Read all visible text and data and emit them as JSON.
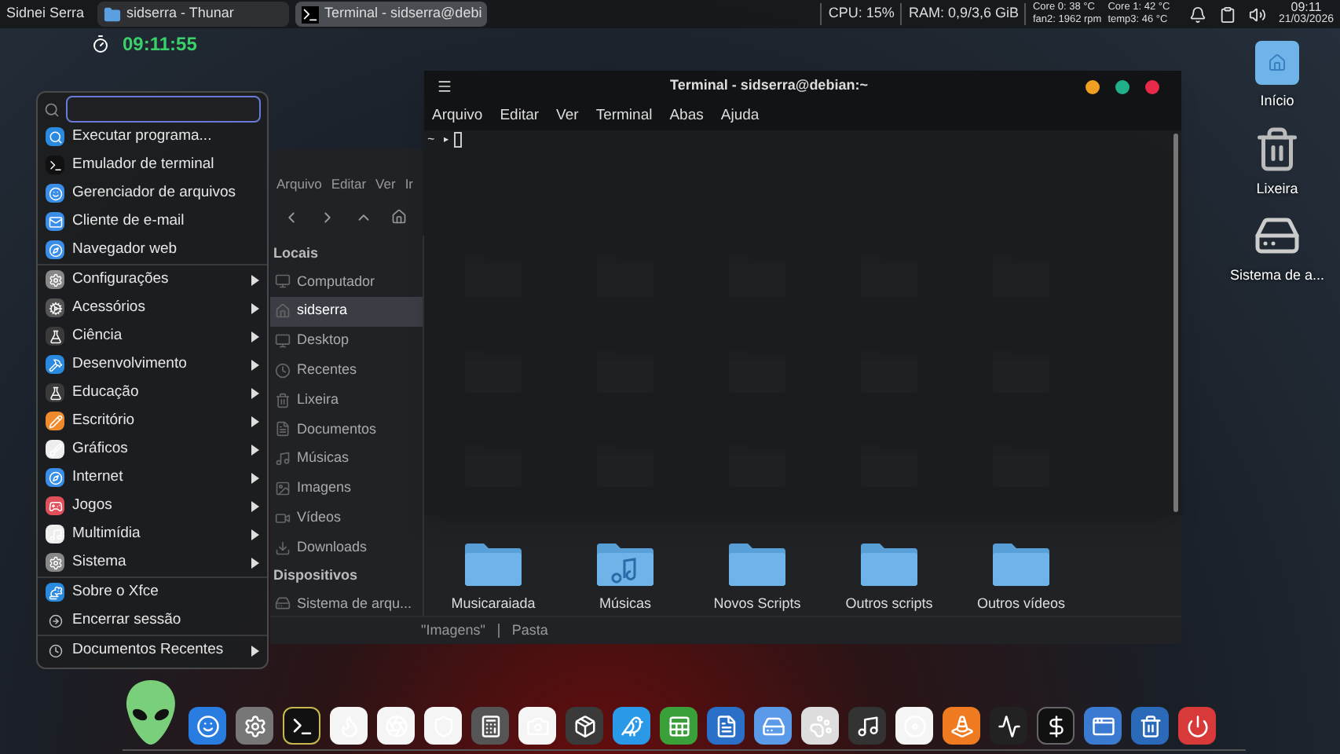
{
  "top_panel": {
    "user": "Sidnei Serra",
    "tasks": [
      {
        "label": "sidserra - Thunar",
        "kind": "folder",
        "selected": false
      },
      {
        "label": "Terminal - sidserra@debi",
        "kind": "terminal",
        "selected": true
      }
    ],
    "cpu": "CPU: 15%",
    "ram": "RAM: 0,9/3,6 GiB",
    "sensors": [
      "Core 0: 38 °C",
      "Core 1: 42 °C",
      "fan2: 1962 rpm",
      "temp3: 46 °C"
    ],
    "clock_time": "09:11",
    "clock_date": "21/03/2026"
  },
  "conky": {
    "clock": "09:11:55"
  },
  "app_menu": {
    "sections": [
      [
        {
          "label": "Executar programa...",
          "submenu": false
        },
        {
          "label": "Emulador de terminal",
          "submenu": false
        },
        {
          "label": "Gerenciador de arquivos",
          "submenu": false
        },
        {
          "label": "Cliente de e-mail",
          "submenu": false
        },
        {
          "label": "Navegador web",
          "submenu": false
        }
      ],
      [
        {
          "label": "Configurações",
          "submenu": true
        },
        {
          "label": "Acessórios",
          "submenu": true
        },
        {
          "label": "Ciência",
          "submenu": true
        },
        {
          "label": "Desenvolvimento",
          "submenu": true
        },
        {
          "label": "Educação",
          "submenu": true
        },
        {
          "label": "Escritório",
          "submenu": true
        },
        {
          "label": "Gráficos",
          "submenu": true
        },
        {
          "label": "Internet",
          "submenu": true
        },
        {
          "label": "Jogos",
          "submenu": true
        },
        {
          "label": "Multimídia",
          "submenu": true
        },
        {
          "label": "Sistema",
          "submenu": true
        }
      ],
      [
        {
          "label": "Sobre o Xfce",
          "submenu": false
        },
        {
          "label": "Encerrar sessão",
          "submenu": false
        }
      ],
      [
        {
          "label": "Documentos Recentes",
          "submenu": true
        }
      ]
    ]
  },
  "thunar": {
    "menu": [
      "Arquivo",
      "Editar",
      "Ver",
      "Ir"
    ],
    "sidebar": [
      {
        "heading": "Locais",
        "items": [
          {
            "label": "Computador",
            "selected": false
          },
          {
            "label": "sidserra",
            "selected": true
          },
          {
            "label": "Desktop",
            "selected": false
          },
          {
            "label": "Recentes",
            "selected": false
          },
          {
            "label": "Lixeira",
            "selected": false
          },
          {
            "label": "Documentos",
            "selected": false
          },
          {
            "label": "Músicas",
            "selected": false
          },
          {
            "label": "Imagens",
            "selected": false
          },
          {
            "label": "Vídeos",
            "selected": false
          },
          {
            "label": "Downloads",
            "selected": false
          }
        ]
      },
      {
        "heading": "Dispositivos",
        "items": [
          {
            "label": "Sistema de arqu...",
            "selected": false
          }
        ]
      }
    ],
    "folders": [
      {
        "label": "Musicaraiada",
        "kind": "plain"
      },
      {
        "label": "Músicas",
        "kind": "music"
      },
      {
        "label": "Novos Scripts",
        "kind": "plain"
      },
      {
        "label": "Outros scripts",
        "kind": "plain"
      },
      {
        "label": "Outros vídeos",
        "kind": "plain"
      }
    ],
    "status": [
      "\"Imagens\"",
      "Pasta"
    ]
  },
  "terminal": {
    "title": "Terminal - sidserra@debian:~",
    "menu": [
      "Arquivo",
      "Editar",
      "Ver",
      "Terminal",
      "Abas",
      "Ajuda"
    ],
    "prompt": "~ ▸"
  },
  "desktop_icons": [
    {
      "label": "Início",
      "kind": "home"
    },
    {
      "label": "Lixeira",
      "kind": "trash"
    },
    {
      "label": "Sistema de a...",
      "kind": "drive"
    }
  ]
}
